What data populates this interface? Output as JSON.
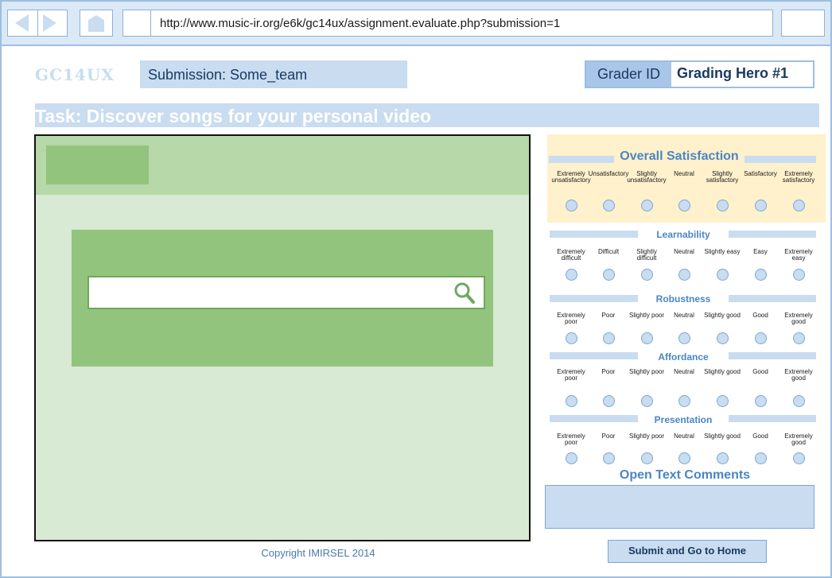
{
  "browser": {
    "url": "http://www.music-ir.org/e6k/gc14ux/assignment.evaluate.php?submission=1"
  },
  "header": {
    "logo": "GC14UX",
    "submission": "Submission: Some_team",
    "grader_label": "Grader ID",
    "grader_value": "Grading Hero #1"
  },
  "task": "Task: Discover songs for your personal video",
  "sections": [
    {
      "title": "Overall Satisfaction",
      "options": [
        "Extremely unsatisfactory",
        "Unsatisfactory",
        "Slightly unsatisfactory",
        "Neutral",
        "Slightly satisfactory",
        "Satisfactory",
        "Extremely satisfactory"
      ]
    },
    {
      "title": "Learnability",
      "options": [
        "Extremely difficult",
        "Difficult",
        "Slightly difficult",
        "Neutral",
        "Slightly easy",
        "Easy",
        "Extremely easy"
      ]
    },
    {
      "title": "Robustness",
      "options": [
        "Extremely poor",
        "Poor",
        "Slightly poor",
        "Neutral",
        "Slightly good",
        "Good",
        "Extremely good"
      ]
    },
    {
      "title": "Affordance",
      "options": [
        "Extremely poor",
        "Poor",
        "Slightly poor",
        "Neutral",
        "Slightly good",
        "Good",
        "Extremely good"
      ]
    },
    {
      "title": "Presentation",
      "options": [
        "Extremely poor",
        "Poor",
        "Slightly poor",
        "Neutral",
        "Slightly good",
        "Good",
        "Extremely good"
      ]
    }
  ],
  "comments": {
    "title": "Open Text Comments",
    "value": ""
  },
  "footer": {
    "copyright": "Copyright IMIRSEL 2014",
    "submit_label": "Submit and Go to Home"
  },
  "colors": {
    "accent": "#4a86c5",
    "light_blue": "#c9dcf0",
    "mock_green": "#93c47d",
    "satisfaction_bg": "#fef1cb"
  },
  "icons": [
    "back-arrow-icon",
    "forward-arrow-icon",
    "home-icon",
    "search-icon"
  ]
}
